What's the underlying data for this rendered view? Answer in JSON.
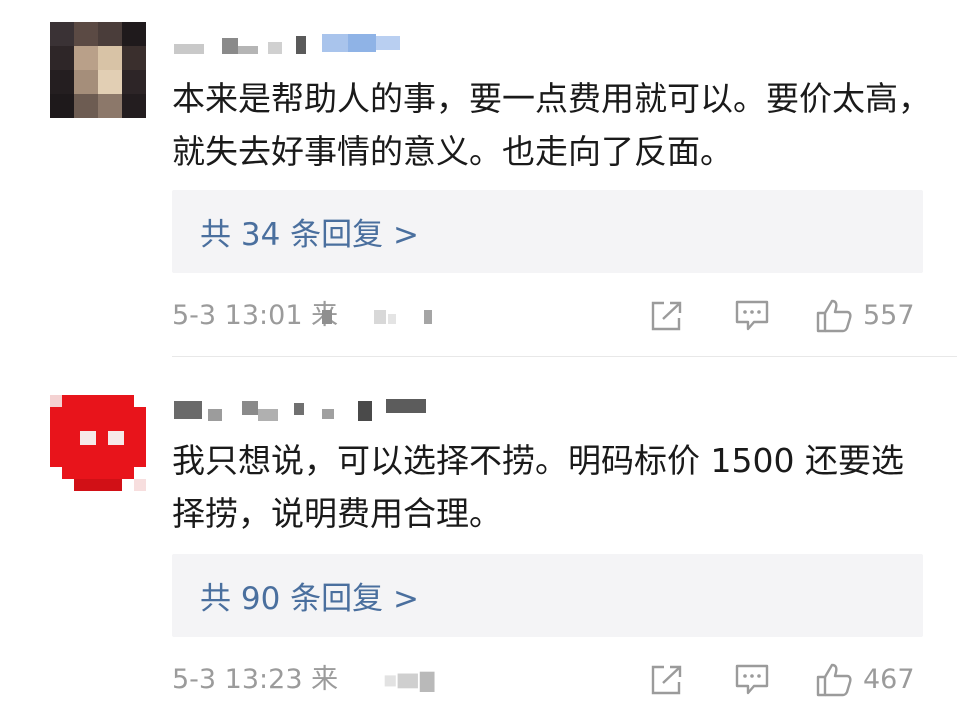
{
  "comments": [
    {
      "text": "本来是帮助人的事，要一点费用就可以。要价太高，就失去好事情的意义。也走向了反面。",
      "replies_label": "共 34 条回复 >",
      "time": "5-3 13:01 来",
      "likes": "557"
    },
    {
      "text": "我只想说，可以选择不捞。明码标价 1500 还要选择捞，说明费用合理。",
      "replies_label": "共 90 条回复 >",
      "time": "5-3 13:23 来",
      "likes": "467"
    }
  ],
  "colors": {
    "text": "#1a1a1a",
    "link": "#4a6f9e",
    "meta": "#9b9b9b",
    "reply_bg": "#f4f4f6",
    "avatar_red": "#e8141b"
  },
  "icons": [
    "share-icon",
    "comment-icon",
    "thumbs-up-icon"
  ]
}
